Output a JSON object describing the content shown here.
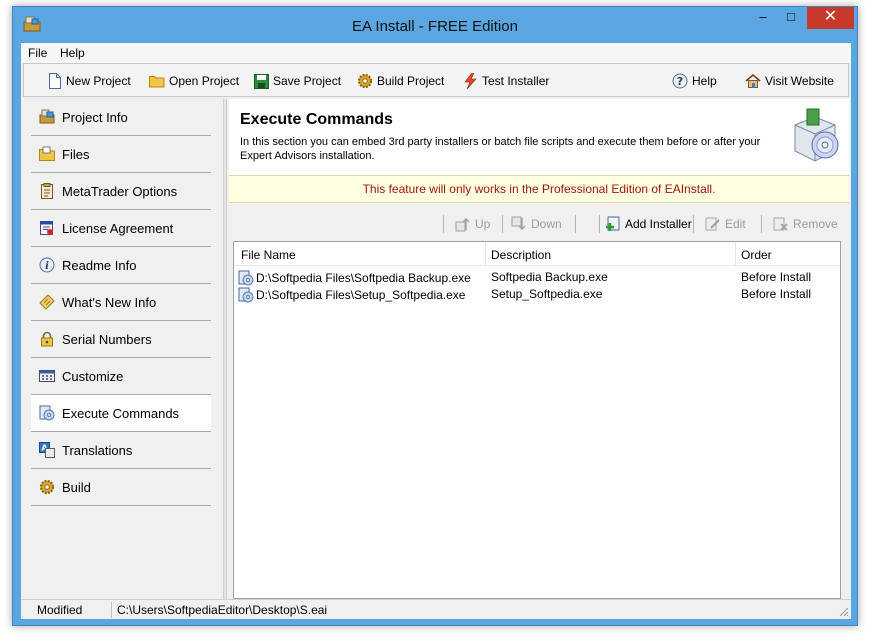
{
  "window": {
    "title": "EA Install - FREE Edition",
    "minimize_glyph": "–",
    "maximize_glyph": "□",
    "close_glyph": "✕"
  },
  "menu": {
    "items": [
      "File",
      "Help"
    ]
  },
  "toolbar": {
    "new_project": "New Project",
    "open_project": "Open Project",
    "save_project": "Save Project",
    "build_project": "Build Project",
    "test_installer": "Test Installer",
    "help": "Help",
    "visit_website": "Visit Website"
  },
  "sidebar": {
    "active": "Execute Commands",
    "items": [
      {
        "label": "Project Info",
        "icon": "project-info-icon"
      },
      {
        "label": "Files",
        "icon": "files-icon"
      },
      {
        "label": "MetaTrader Options",
        "icon": "metatrader-options-icon"
      },
      {
        "label": "License Agreement",
        "icon": "license-agreement-icon"
      },
      {
        "label": "Readme Info",
        "icon": "info-icon"
      },
      {
        "label": "What's New Info",
        "icon": "whats-new-icon"
      },
      {
        "label": "Serial Numbers",
        "icon": "lock-icon"
      },
      {
        "label": "Customize",
        "icon": "customize-icon"
      },
      {
        "label": "Execute Commands",
        "icon": "execute-commands-icon"
      },
      {
        "label": "Translations",
        "icon": "translations-icon"
      },
      {
        "label": "Build",
        "icon": "gear-icon"
      }
    ]
  },
  "header": {
    "title": "Execute Commands",
    "description": "In this section you can embed 3rd party installers or batch file scripts and execute them before or after your Expert Advisors installation."
  },
  "notice": "This feature will only works in the Professional Edition of EAInstall.",
  "commands_toolbar": {
    "up": "Up",
    "down": "Down",
    "add_installer": "Add Installer",
    "edit": "Edit",
    "remove": "Remove"
  },
  "table": {
    "columns": [
      "File Name",
      "Description",
      "Order"
    ],
    "rows": [
      {
        "file": "D:\\Softpedia Files\\Softpedia Backup.exe",
        "description": "Softpedia Backup.exe",
        "order": "Before Install"
      },
      {
        "file": "D:\\Softpedia Files\\Setup_Softpedia.exe",
        "description": "Setup_Softpedia.exe",
        "order": "Before Install"
      }
    ]
  },
  "statusbar": {
    "state": "Modified",
    "path": "C:\\Users\\SoftpediaEditor\\Desktop\\S.eai"
  },
  "colors": {
    "frame": "#5aa6e0",
    "close_button": "#c7392b",
    "notice_background": "#ffffe1",
    "notice_text": "#a0150f"
  }
}
